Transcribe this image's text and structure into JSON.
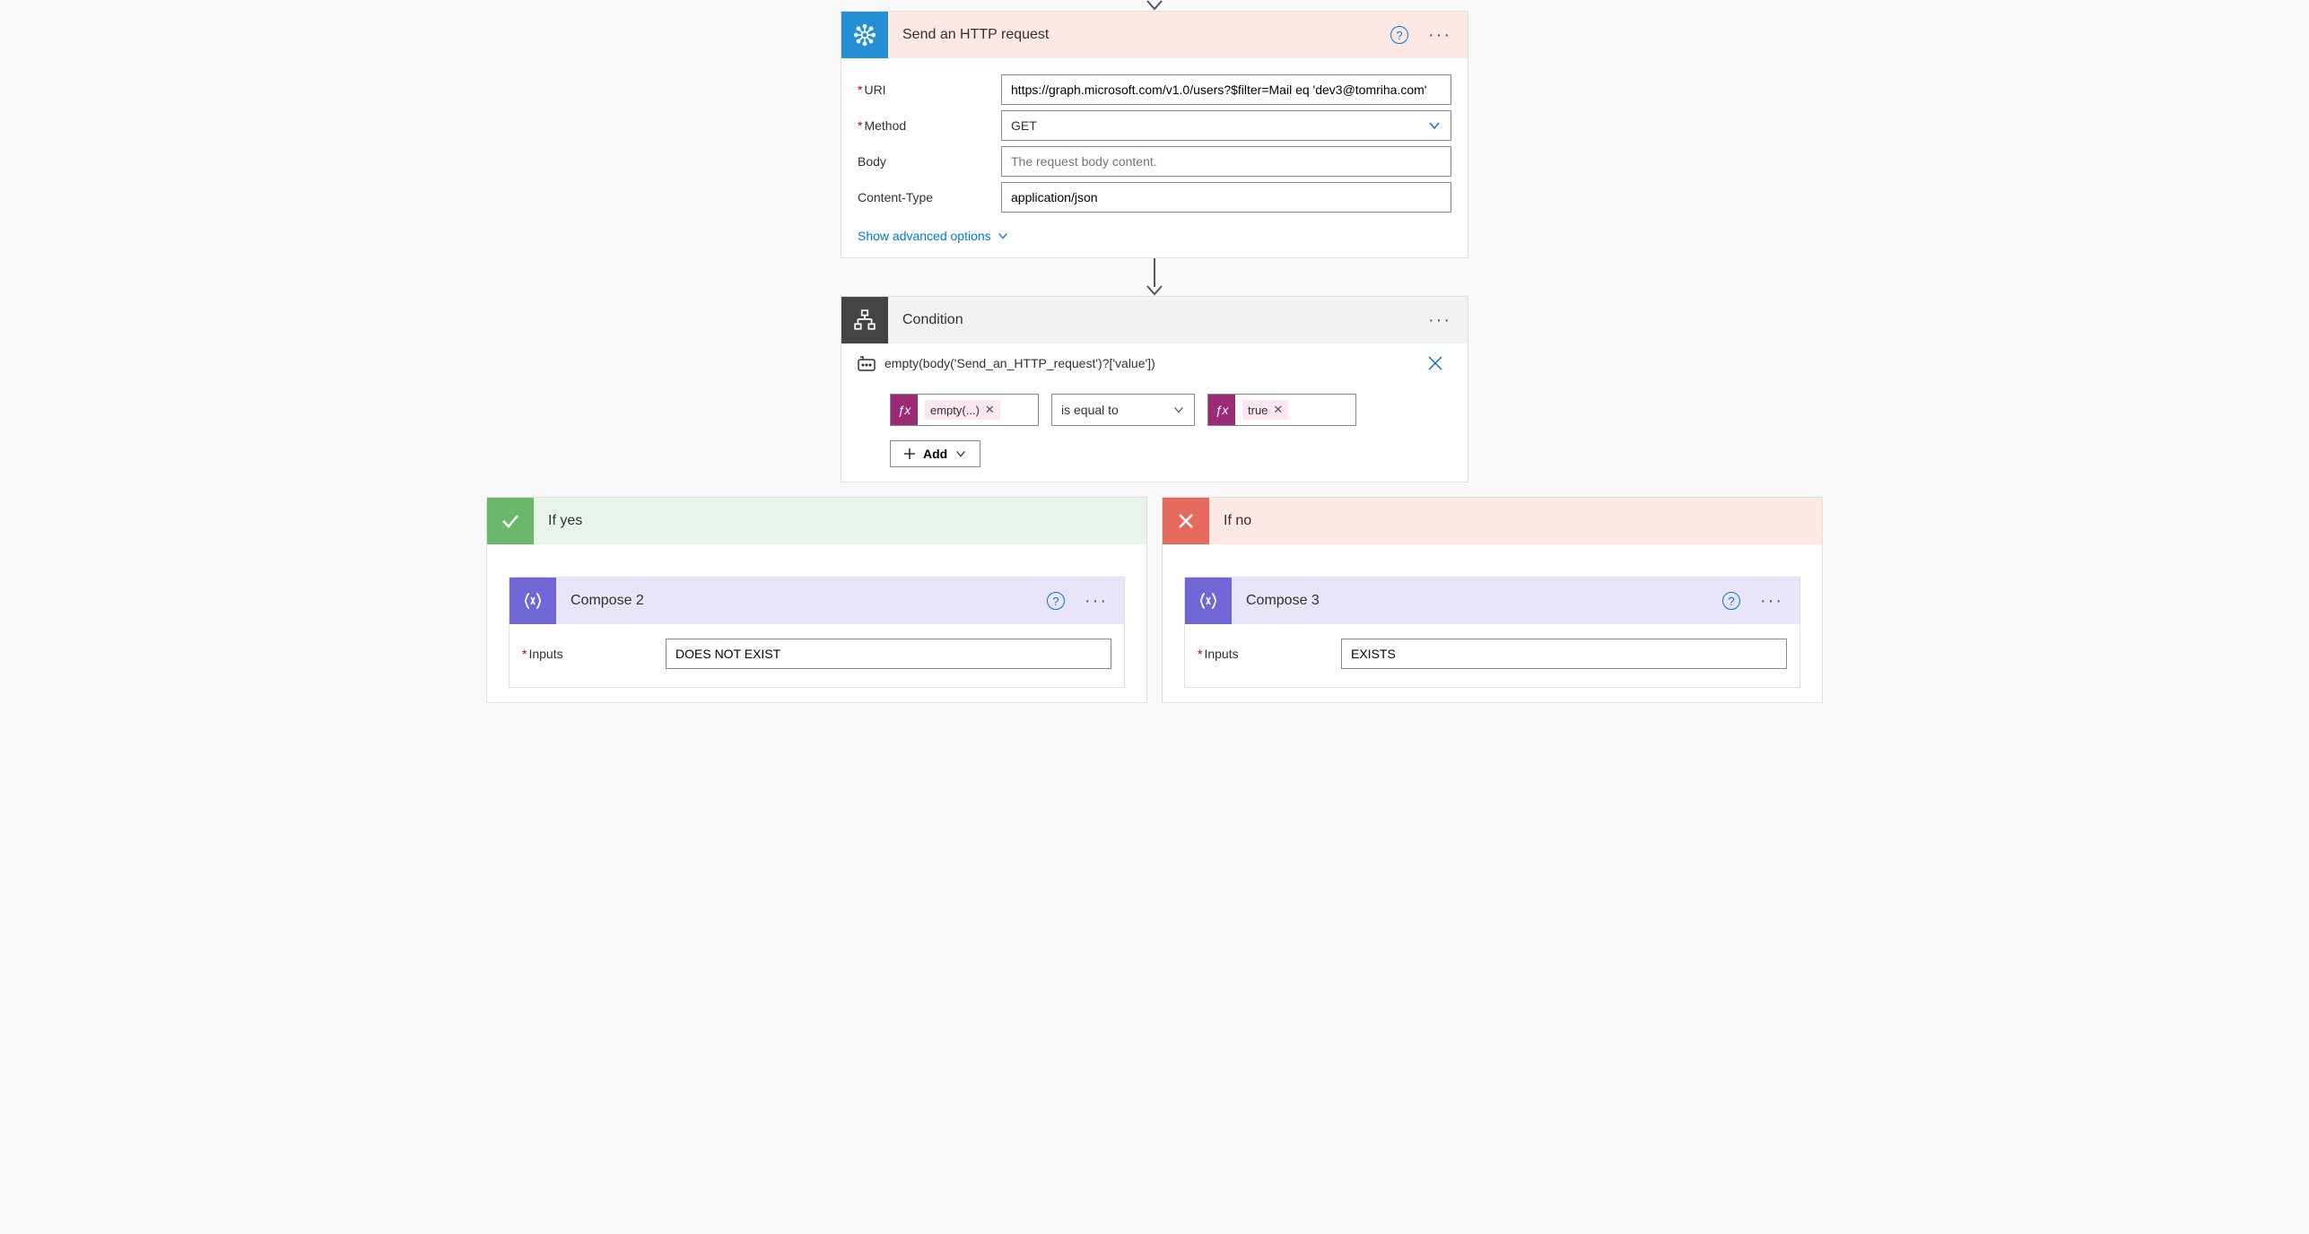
{
  "http_card": {
    "title": "Send an HTTP request",
    "fields": {
      "uri_label": "URI",
      "uri_value": "https://graph.microsoft.com/v1.0/users?$filter=Mail eq 'dev3@tomriha.com'",
      "method_label": "Method",
      "method_value": "GET",
      "body_label": "Body",
      "body_placeholder": "The request body content.",
      "ctype_label": "Content-Type",
      "ctype_value": "application/json"
    },
    "advanced_toggle": "Show advanced options"
  },
  "condition_card": {
    "title": "Condition",
    "expression": "empty(body('Send_an_HTTP_request')?['value'])",
    "left_pill": "empty(...)",
    "operator": "is equal to",
    "right_pill": "true",
    "add_label": "Add"
  },
  "branches": {
    "yes": {
      "title": "If yes",
      "compose_title": "Compose 2",
      "inputs_label": "Inputs",
      "inputs_value": "DOES NOT EXIST"
    },
    "no": {
      "title": "If no",
      "compose_title": "Compose 3",
      "inputs_label": "Inputs",
      "inputs_value": "EXISTS"
    }
  }
}
